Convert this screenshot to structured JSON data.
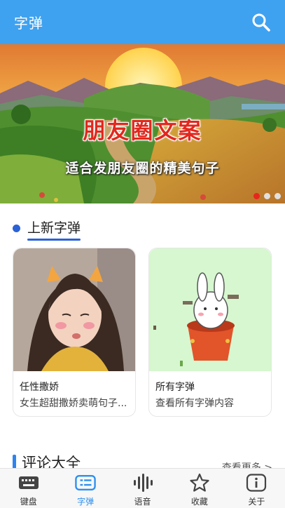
{
  "header": {
    "title": "字弹",
    "search_icon": "search-icon"
  },
  "banner": {
    "headline": "朋友圈文案",
    "subline": "适合发朋友圈的精美句子",
    "dots": 3,
    "active_dot": 0
  },
  "new_section": {
    "title": "上新字弹"
  },
  "cards": [
    {
      "name": "任性撒娇",
      "desc": "女生超甜撒娇卖萌句子..."
    },
    {
      "name": "所有字弹",
      "desc": "查看所有字弹内容"
    }
  ],
  "comment_section": {
    "title": "评论大全",
    "more": "查看更多 >"
  },
  "tabs": [
    {
      "label": "键盘",
      "icon": "keyboard-icon",
      "active": false
    },
    {
      "label": "字弹",
      "icon": "list-icon",
      "active": true
    },
    {
      "label": "语音",
      "icon": "voice-wave-icon",
      "active": false
    },
    {
      "label": "收藏",
      "icon": "star-icon",
      "active": false
    },
    {
      "label": "关于",
      "icon": "info-icon",
      "active": false
    }
  ],
  "colors": {
    "primary": "#3fa2f0",
    "accent": "#2b62d6",
    "active_dot": "#e8261e"
  }
}
